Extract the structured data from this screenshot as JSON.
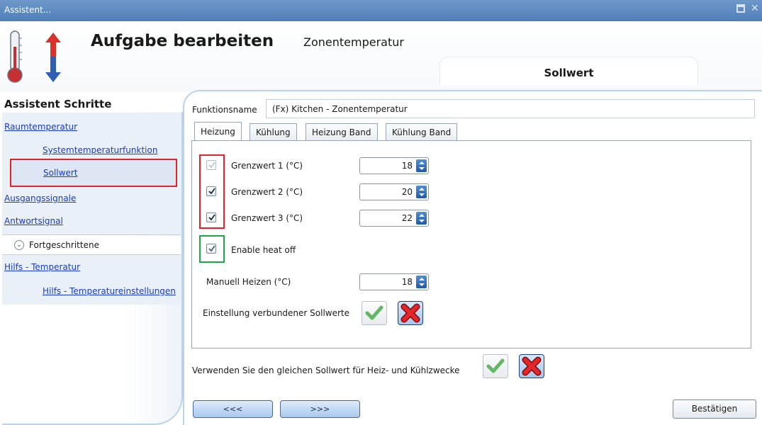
{
  "window": {
    "title": "Assistent...",
    "controls": [
      "restore-icon",
      "close-icon"
    ]
  },
  "header": {
    "title": "Aufgabe bearbeiten",
    "subtitle": "Zonentemperatur",
    "active_section": "Sollwert",
    "icon": "thermometer-icon"
  },
  "sidebar": {
    "heading": "Assistent Schritte",
    "items": [
      {
        "label": "Raumtemperatur",
        "level": 0
      },
      {
        "label": "Systemtemperaturfunktion",
        "level": 1
      },
      {
        "label": "Sollwert",
        "level": 1,
        "selected": true
      },
      {
        "label": "Ausgangssignale",
        "level": 0
      },
      {
        "label": "Antwortsignal",
        "level": 0
      }
    ],
    "group": {
      "label": "Fortgeschrittene",
      "icon": "chevron-down-icon"
    },
    "group_items": [
      {
        "label": "Hilfs - Temperatur",
        "level": 0
      },
      {
        "label": "Hilfs - Temperatureinstellungen",
        "level": 1
      }
    ]
  },
  "form": {
    "function_name_label": "Funktionsname",
    "function_name_value": "(Fx) Kitchen - Zonentemperatur",
    "tabs": [
      "Heizung",
      "Kühlung",
      "Heizung Band",
      "Kühlung Band"
    ],
    "active_tab": "Heizung",
    "thresholds": [
      {
        "label": "Grenzwert 1 (°C)",
        "value": "18",
        "checked": true,
        "enabled": false
      },
      {
        "label": "Grenzwert 2 (°C)",
        "value": "20",
        "checked": true,
        "enabled": true
      },
      {
        "label": "Grenzwert 3 (°C)",
        "value": "22",
        "checked": true,
        "enabled": true
      }
    ],
    "enable_heat_off": {
      "label": "Enable heat off",
      "checked": true
    },
    "manual_heat": {
      "label": "Manuell Heizen (°C)",
      "value": "18"
    },
    "linked_setpoints_label": "Einstellung verbundener Sollwerte",
    "same_setpoint_label": "Verwenden Sie den gleichen Sollwert für Heiz- und Kühlzwecke"
  },
  "footer": {
    "prev_label": "<<<",
    "next_label": ">>>",
    "confirm_label": "Bestätigen"
  },
  "colors": {
    "titlebar": "#5a89c2",
    "highlight_red": "#e2232a",
    "highlight_green": "#22a34b",
    "link": "#1a3cc4",
    "accent_blue": "#2a6bc2"
  }
}
